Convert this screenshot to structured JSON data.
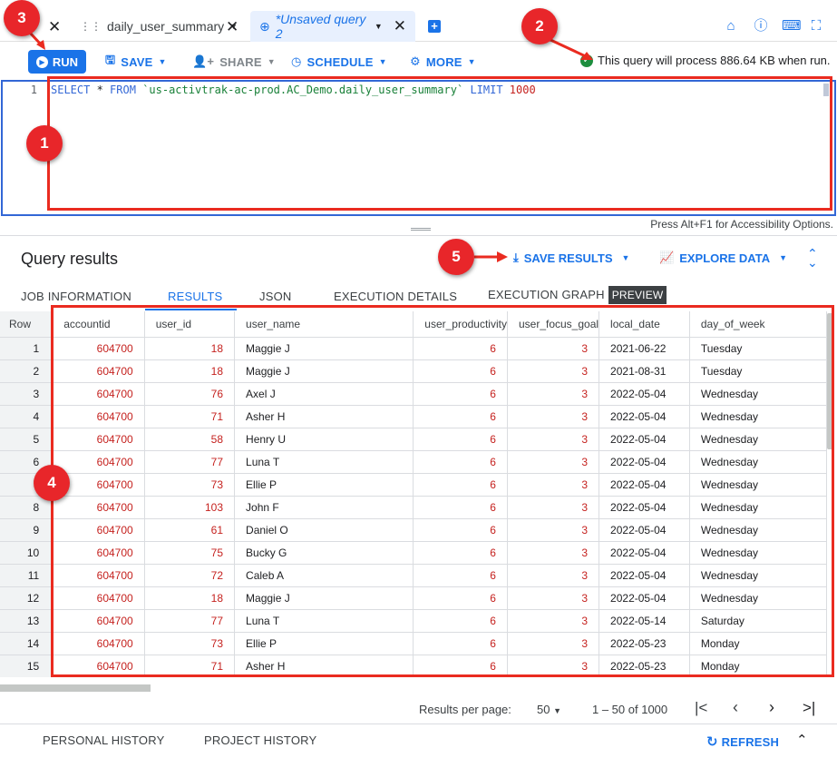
{
  "tabs": [
    {
      "label": "daily_user_summary",
      "active": false
    },
    {
      "label": "*Unsaved query 2",
      "active": true
    }
  ],
  "toolbar": {
    "run": "RUN",
    "save": "SAVE",
    "share": "SHARE",
    "schedule": "SCHEDULE",
    "more": "MORE",
    "status": "This query will process 886.64 KB when run."
  },
  "editor": {
    "line_number": "1",
    "kw1": "SELECT",
    "star": " * ",
    "kw2": "FROM",
    "table_ref": "`us-activtrak-ac-prod.AC_Demo.daily_user_summary`",
    "kw3": "LIMIT",
    "limit": "1000",
    "accessibility": "Press Alt+F1 for Accessibility Options."
  },
  "results": {
    "title": "Query results",
    "save_results": "SAVE RESULTS",
    "explore_data": "EXPLORE DATA",
    "subtabs": [
      "JOB INFORMATION",
      "RESULTS",
      "JSON",
      "EXECUTION DETAILS",
      "EXECUTION GRAPH"
    ],
    "preview_badge": "PREVIEW",
    "columns": [
      "Row",
      "accountid",
      "user_id",
      "user_name",
      "user_productivity",
      "user_focus_goal",
      "local_date",
      "day_of_week"
    ],
    "rows": [
      [
        "1",
        "604700",
        "18",
        "Maggie J",
        "6",
        "3",
        "2021-06-22",
        "Tuesday"
      ],
      [
        "2",
        "604700",
        "18",
        "Maggie J",
        "6",
        "3",
        "2021-08-31",
        "Tuesday"
      ],
      [
        "3",
        "604700",
        "76",
        "Axel J",
        "6",
        "3",
        "2022-05-04",
        "Wednesday"
      ],
      [
        "4",
        "604700",
        "71",
        "Asher H",
        "6",
        "3",
        "2022-05-04",
        "Wednesday"
      ],
      [
        "5",
        "604700",
        "58",
        "Henry U",
        "6",
        "3",
        "2022-05-04",
        "Wednesday"
      ],
      [
        "6",
        "604700",
        "77",
        "Luna T",
        "6",
        "3",
        "2022-05-04",
        "Wednesday"
      ],
      [
        "7",
        "604700",
        "73",
        "Ellie P",
        "6",
        "3",
        "2022-05-04",
        "Wednesday"
      ],
      [
        "8",
        "604700",
        "103",
        "John F",
        "6",
        "3",
        "2022-05-04",
        "Wednesday"
      ],
      [
        "9",
        "604700",
        "61",
        "Daniel O",
        "6",
        "3",
        "2022-05-04",
        "Wednesday"
      ],
      [
        "10",
        "604700",
        "75",
        "Bucky G",
        "6",
        "3",
        "2022-05-04",
        "Wednesday"
      ],
      [
        "11",
        "604700",
        "72",
        "Caleb A",
        "6",
        "3",
        "2022-05-04",
        "Wednesday"
      ],
      [
        "12",
        "604700",
        "18",
        "Maggie J",
        "6",
        "3",
        "2022-05-04",
        "Wednesday"
      ],
      [
        "13",
        "604700",
        "77",
        "Luna T",
        "6",
        "3",
        "2022-05-14",
        "Saturday"
      ],
      [
        "14",
        "604700",
        "73",
        "Ellie P",
        "6",
        "3",
        "2022-05-23",
        "Monday"
      ],
      [
        "15",
        "604700",
        "71",
        "Asher H",
        "6",
        "3",
        "2022-05-23",
        "Monday"
      ]
    ]
  },
  "pager": {
    "label": "Results per page:",
    "per_page": "50",
    "range": "1 – 50 of 1000"
  },
  "bottom": {
    "personal_history": "PERSONAL HISTORY",
    "project_history": "PROJECT HISTORY",
    "refresh": "REFRESH"
  },
  "annotations": [
    "1",
    "2",
    "3",
    "4",
    "5"
  ],
  "colors": {
    "accent": "#1a73e8",
    "annotation_red": "#ea2b20",
    "success": "#1e8e3e"
  }
}
